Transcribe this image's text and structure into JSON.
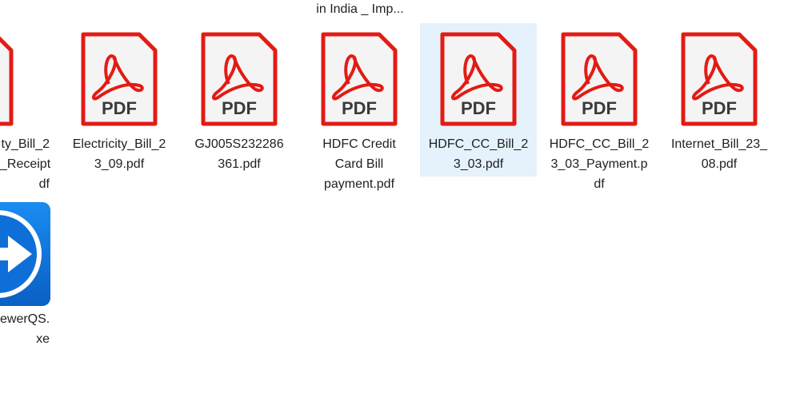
{
  "top_label": "in India _ Imp...",
  "files": [
    {
      "name": "ty_Bill_2\n_Receipt\ndf",
      "type": "pdf",
      "selected": false
    },
    {
      "name": "Electricity_Bill_2\n3_09.pdf",
      "type": "pdf",
      "selected": false
    },
    {
      "name": "GJ005S232286\n361.pdf",
      "type": "pdf",
      "selected": false
    },
    {
      "name": "HDFC Credit\nCard Bill\npayment.pdf",
      "type": "pdf",
      "selected": false
    },
    {
      "name": "HDFC_CC_Bill_2\n3_03.pdf",
      "type": "pdf",
      "selected": true
    },
    {
      "name": "HDFC_CC_Bill_2\n3_03_Payment.p\ndf",
      "type": "pdf",
      "selected": false
    },
    {
      "name": "Internet_Bill_23_\n08.pdf",
      "type": "pdf",
      "selected": false
    }
  ],
  "exe_file": {
    "name": "ewerQS.\nxe",
    "type": "exe",
    "icon": "teamviewer-icon"
  },
  "pdf_icon_label": "PDF",
  "colors": {
    "pdf_red": "#e31b14",
    "pdf_bg": "#f4f4f4",
    "selection": "#e5f1fb",
    "teamviewer_blue": "#0e6fd8"
  }
}
